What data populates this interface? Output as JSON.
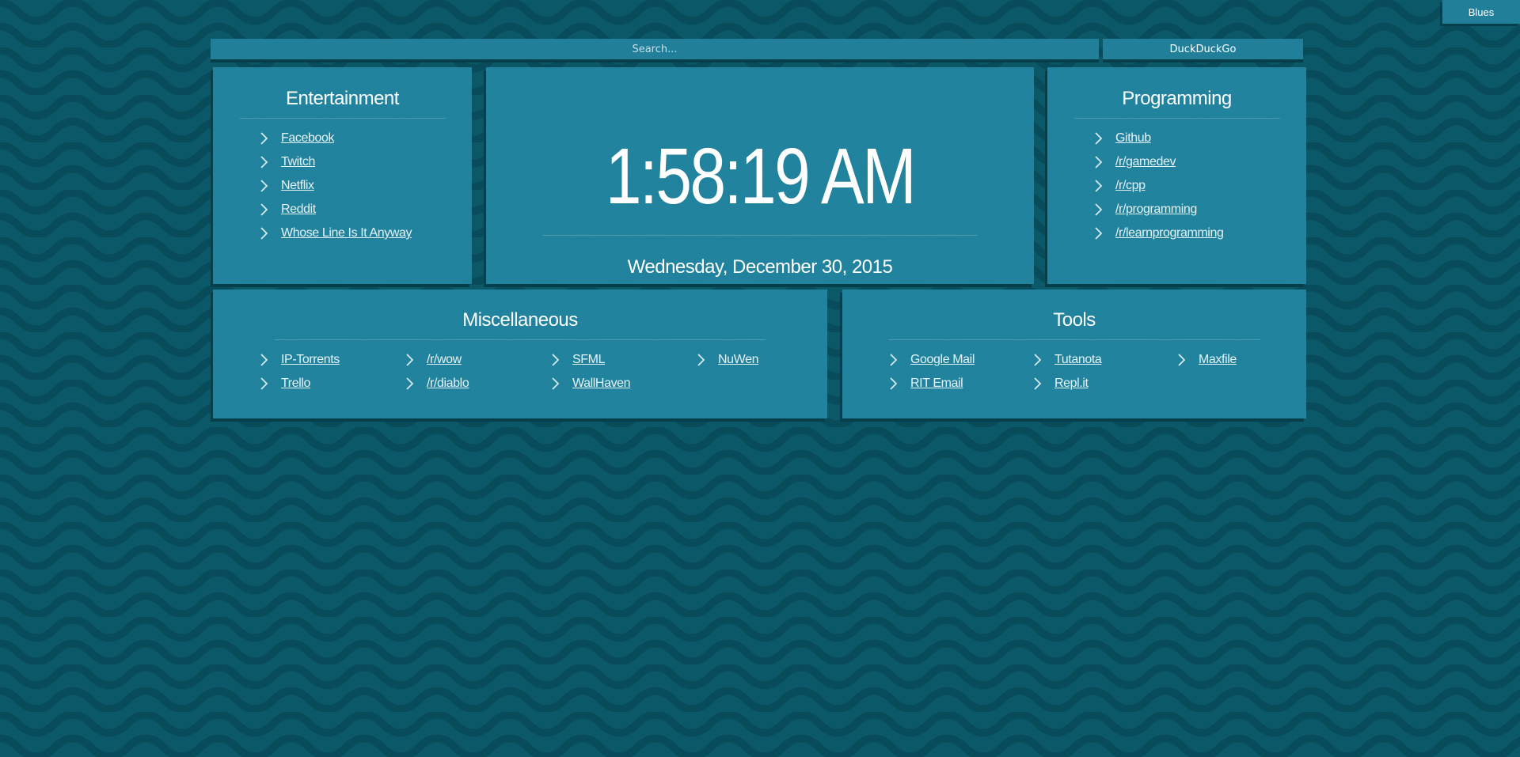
{
  "theme_button": "Blues",
  "search": {
    "placeholder": "Search..."
  },
  "engine_button": "DuckDuckGo",
  "clock": {
    "time": "1:58:19 AM",
    "date": "Wednesday, December 30, 2015"
  },
  "entertainment": {
    "title": "Entertainment",
    "links": [
      "Facebook",
      "Twitch",
      "Netflix",
      "Reddit",
      "Whose Line Is It Anyway"
    ]
  },
  "programming": {
    "title": "Programming",
    "links": [
      "Github",
      "/r/gamedev",
      "/r/cpp",
      "/r/programming",
      "/r/learnprogramming"
    ]
  },
  "miscellaneous": {
    "title": "Miscellaneous",
    "links": [
      "IP-Torrents",
      "/r/wow",
      "SFML",
      "NuWen",
      "Trello",
      "/r/diablo",
      "WallHaven"
    ]
  },
  "tools": {
    "title": "Tools",
    "links": [
      "Google Mail",
      "Tutanota",
      "Maxfile",
      "RIT Email",
      "Repl.it"
    ]
  },
  "icons": {
    "link_bullet": "chevron-right-icon"
  },
  "colors": {
    "background": "#0b5869",
    "panel": "#2487a2",
    "shadow": "#063f4c",
    "text": "#ffffff"
  }
}
